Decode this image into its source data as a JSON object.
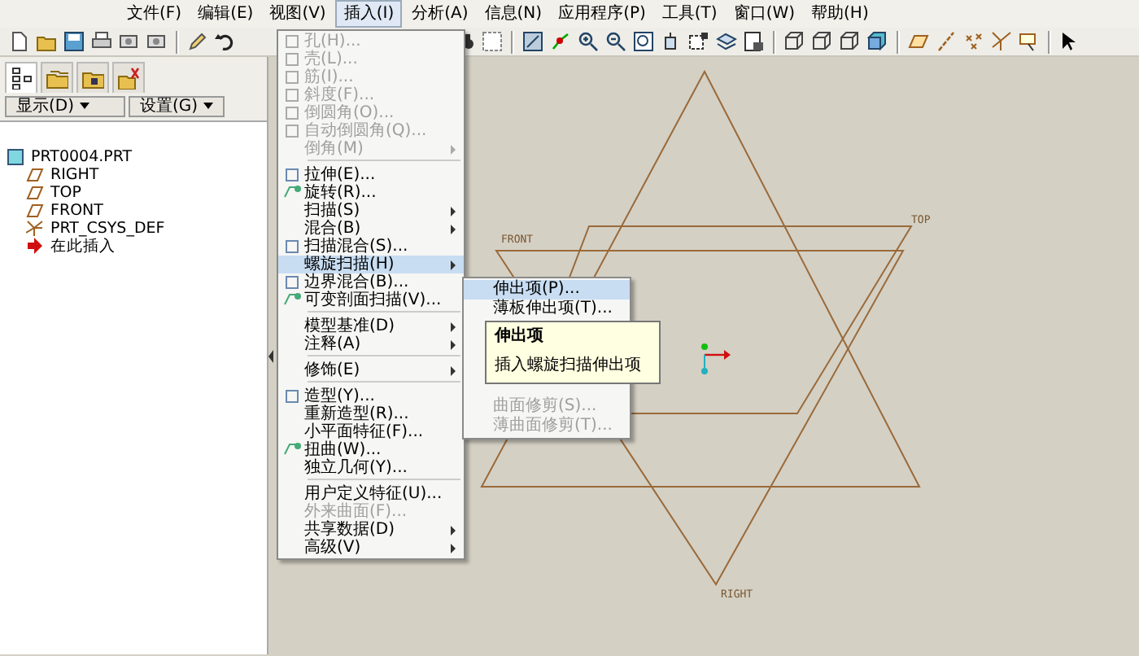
{
  "menubar": [
    {
      "label": "文件(F)",
      "selected": false
    },
    {
      "label": "编辑(E)",
      "selected": false
    },
    {
      "label": "视图(V)",
      "selected": false
    },
    {
      "label": "插入(I)",
      "selected": true
    },
    {
      "label": "分析(A)",
      "selected": false
    },
    {
      "label": "信息(N)",
      "selected": false
    },
    {
      "label": "应用程序(P)",
      "selected": false
    },
    {
      "label": "工具(T)",
      "selected": false
    },
    {
      "label": "窗口(W)",
      "selected": false
    },
    {
      "label": "帮助(H)",
      "selected": false
    }
  ],
  "panel_tabs": [
    {
      "kind": "tree",
      "selected": true
    },
    {
      "kind": "folder",
      "selected": false
    },
    {
      "kind": "favorites",
      "selected": false
    },
    {
      "kind": "layers",
      "selected": false
    }
  ],
  "panel_buttons": [
    "显示(D)",
    "设置(G)"
  ],
  "model_tree": {
    "label": "PRT0004.PRT",
    "kind": "part",
    "children": [
      {
        "label": "RIGHT",
        "kind": "plane"
      },
      {
        "label": "TOP",
        "kind": "plane"
      },
      {
        "label": "FRONT",
        "kind": "plane"
      },
      {
        "label": "PRT_CSYS_DEF",
        "kind": "csys"
      },
      {
        "label": "在此插入",
        "kind": "insert"
      }
    ]
  },
  "insert_menu": [
    {
      "kind": "item",
      "label": "孔(H)...",
      "icon": true,
      "disabled": true,
      "submenu": false,
      "selected": false
    },
    {
      "kind": "item",
      "label": "壳(L)...",
      "icon": true,
      "disabled": true,
      "submenu": false,
      "selected": false
    },
    {
      "kind": "item",
      "label": "筋(I)...",
      "icon": true,
      "disabled": true,
      "submenu": false,
      "selected": false
    },
    {
      "kind": "item",
      "label": "斜度(F)...",
      "icon": true,
      "disabled": true,
      "submenu": false,
      "selected": false
    },
    {
      "kind": "item",
      "label": "倒圆角(O)...",
      "icon": true,
      "disabled": true,
      "submenu": false,
      "selected": false
    },
    {
      "kind": "item",
      "label": "自动倒圆角(Q)...",
      "icon": true,
      "disabled": true,
      "submenu": false,
      "selected": false
    },
    {
      "kind": "item",
      "label": "倒角(M)",
      "icon": false,
      "disabled": true,
      "submenu": true,
      "selected": false
    },
    {
      "kind": "separator"
    },
    {
      "kind": "item",
      "label": "拉伸(E)...",
      "icon": true,
      "disabled": false,
      "submenu": false,
      "selected": false
    },
    {
      "kind": "item",
      "label": "旋转(R)...",
      "icon": true,
      "disabled": false,
      "submenu": false,
      "selected": false
    },
    {
      "kind": "item",
      "label": "扫描(S)",
      "icon": false,
      "disabled": false,
      "submenu": true,
      "selected": false
    },
    {
      "kind": "item",
      "label": "混合(B)",
      "icon": false,
      "disabled": false,
      "submenu": true,
      "selected": false
    },
    {
      "kind": "item",
      "label": "扫描混合(S)...",
      "icon": true,
      "disabled": false,
      "submenu": false,
      "selected": false
    },
    {
      "kind": "item",
      "label": "螺旋扫描(H)",
      "icon": false,
      "disabled": false,
      "submenu": true,
      "selected": true
    },
    {
      "kind": "item",
      "label": "边界混合(B)...",
      "icon": true,
      "disabled": false,
      "submenu": false,
      "selected": false
    },
    {
      "kind": "item",
      "label": "可变剖面扫描(V)...",
      "icon": true,
      "disabled": false,
      "submenu": false,
      "selected": false
    },
    {
      "kind": "separator"
    },
    {
      "kind": "item",
      "label": "模型基准(D)",
      "icon": false,
      "disabled": false,
      "submenu": true,
      "selected": false
    },
    {
      "kind": "item",
      "label": "注释(A)",
      "icon": false,
      "disabled": false,
      "submenu": true,
      "selected": false
    },
    {
      "kind": "separator"
    },
    {
      "kind": "item",
      "label": "修饰(E)",
      "icon": false,
      "disabled": false,
      "submenu": true,
      "selected": false
    },
    {
      "kind": "separator"
    },
    {
      "kind": "item",
      "label": "造型(Y)...",
      "icon": true,
      "disabled": false,
      "submenu": false,
      "selected": false
    },
    {
      "kind": "item",
      "label": "重新造型(R)...",
      "icon": false,
      "disabled": false,
      "submenu": false,
      "selected": false
    },
    {
      "kind": "item",
      "label": "小平面特征(F)...",
      "icon": false,
      "disabled": false,
      "submenu": false,
      "selected": false
    },
    {
      "kind": "item",
      "label": "扭曲(W)...",
      "icon": true,
      "disabled": false,
      "submenu": false,
      "selected": false
    },
    {
      "kind": "item",
      "label": "独立几何(Y)...",
      "icon": false,
      "disabled": false,
      "submenu": false,
      "selected": false
    },
    {
      "kind": "separator"
    },
    {
      "kind": "item",
      "label": "用户定义特征(U)...",
      "icon": false,
      "disabled": false,
      "submenu": false,
      "selected": false
    },
    {
      "kind": "item",
      "label": "外来曲面(F)...",
      "icon": false,
      "disabled": true,
      "submenu": false,
      "selected": false
    },
    {
      "kind": "item",
      "label": "共享数据(D)",
      "icon": false,
      "disabled": false,
      "submenu": true,
      "selected": false
    },
    {
      "kind": "item",
      "label": "高级(V)",
      "icon": false,
      "disabled": false,
      "submenu": true,
      "selected": false
    }
  ],
  "helical_sweep_submenu": {
    "items_above_tooltip": [
      {
        "label": "伸出项(P)...",
        "selected": true,
        "disabled": false
      },
      {
        "label": "薄板伸出项(T)...",
        "selected": false,
        "disabled": false
      }
    ],
    "items_below_tooltip": [
      {
        "label": "曲面修剪(S)...",
        "selected": false,
        "disabled": true
      },
      {
        "label": "薄曲面修剪(T)...",
        "selected": false,
        "disabled": true
      }
    ]
  },
  "tooltip": {
    "title": "伸出项",
    "text": "插入螺旋扫描伸出项"
  },
  "viewport": {
    "datum_planes": [
      {
        "label": "FRONT",
        "kind": "front"
      },
      {
        "label": "TOP",
        "kind": "top"
      },
      {
        "label": "RIGHT",
        "kind": "right"
      }
    ]
  }
}
